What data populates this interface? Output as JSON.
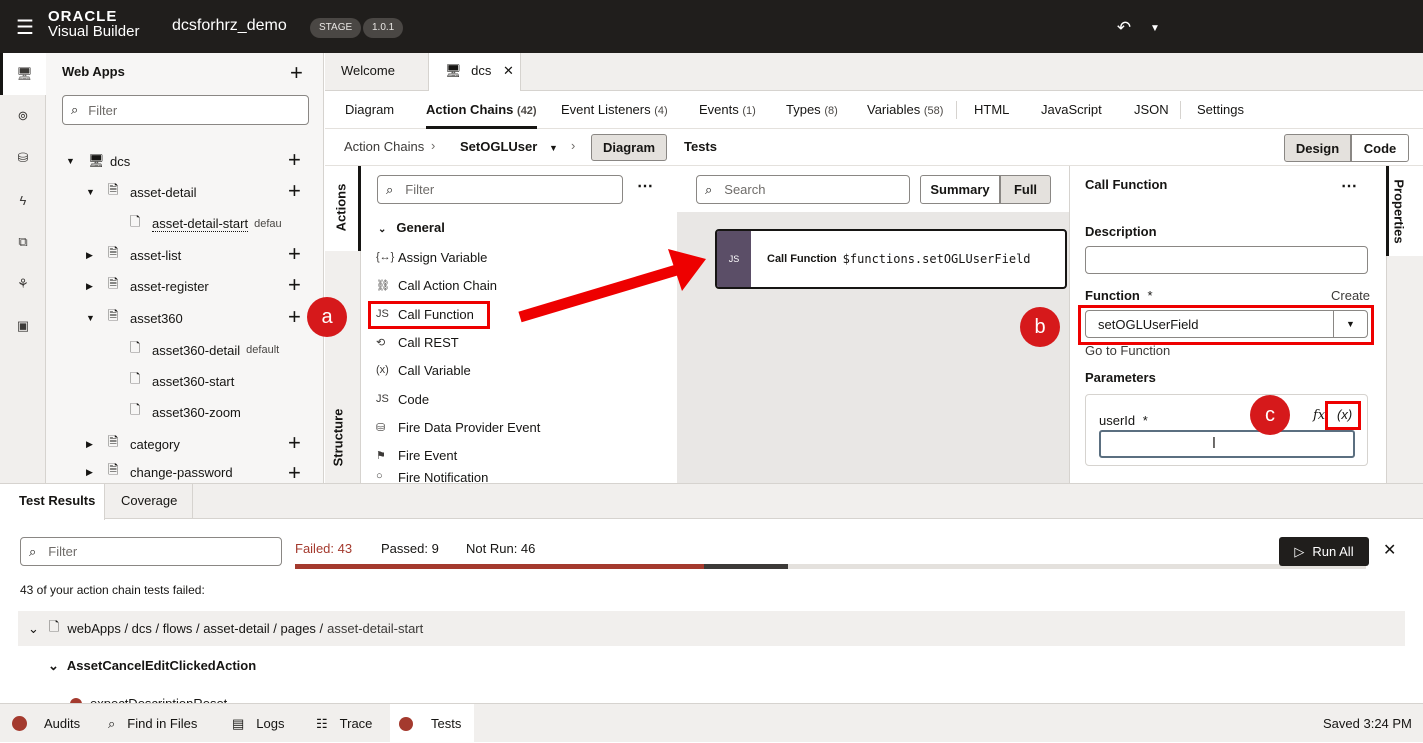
{
  "app": {
    "brand_top": "ORACLE",
    "brand_bottom": "Visual Builder",
    "project": "dcsforhrz_demo",
    "stage_badge": "STAGE",
    "version_badge": "1.0.1"
  },
  "nav": {
    "title": "Web Apps",
    "filter_placeholder": "Filter",
    "tree": [
      {
        "label": "dcs",
        "extra": ""
      },
      {
        "label": "asset-detail",
        "extra": ""
      },
      {
        "label": "asset-detail-start",
        "extra": "defau"
      },
      {
        "label": "asset-list",
        "extra": ""
      },
      {
        "label": "asset-register",
        "extra": ""
      },
      {
        "label": "asset360",
        "extra": ""
      },
      {
        "label": "asset360-detail",
        "extra": "default"
      },
      {
        "label": "asset360-start",
        "extra": ""
      },
      {
        "label": "asset360-zoom",
        "extra": ""
      },
      {
        "label": "category",
        "extra": ""
      },
      {
        "label": "change-password",
        "extra": ""
      }
    ]
  },
  "editor_tabs": [
    {
      "label": "Welcome"
    },
    {
      "label": "dcs"
    }
  ],
  "sub_tabs": [
    {
      "label": "Diagram",
      "count": ""
    },
    {
      "label": "Action Chains",
      "count": "(42)"
    },
    {
      "label": "Event Listeners",
      "count": "(4)"
    },
    {
      "label": "Events",
      "count": "(1)"
    },
    {
      "label": "Types",
      "count": "(8)"
    },
    {
      "label": "Variables",
      "count": "(58)"
    },
    {
      "label": "HTML",
      "count": ""
    },
    {
      "label": "JavaScript",
      "count": ""
    },
    {
      "label": "JSON",
      "count": ""
    },
    {
      "label": "Settings",
      "count": ""
    }
  ],
  "breadcrumb": {
    "root": "Action Chains",
    "current": "SetOGLUser",
    "diagram_btn": "Diagram",
    "tests_btn": "Tests",
    "design_btn": "Design",
    "code_btn": "Code"
  },
  "actions_panel": {
    "side_tab_actions": "Actions",
    "side_tab_structure": "Structure",
    "filter_placeholder": "Filter",
    "group": "General",
    "items": [
      {
        "label": "Assign Variable",
        "icon": "{↔}"
      },
      {
        "label": "Call Action Chain",
        "icon": "⛓"
      },
      {
        "label": "Call Function",
        "icon": "JS"
      },
      {
        "label": "Call REST",
        "icon": "⟲"
      },
      {
        "label": "Call Variable",
        "icon": "(x)"
      },
      {
        "label": "Code",
        "icon": "JS"
      },
      {
        "label": "Fire Data Provider Event",
        "icon": "⛁"
      },
      {
        "label": "Fire Event",
        "icon": "⚑"
      },
      {
        "label": "Fire Notification",
        "icon": "○"
      }
    ]
  },
  "canvas": {
    "search_placeholder": "Search",
    "summary_btn": "Summary",
    "full_btn": "Full",
    "node_title": "Call Function",
    "node_value": "$functions.setOGLUserField"
  },
  "properties": {
    "title": "Call Function",
    "side_tab": "Properties",
    "description_label": "Description",
    "description_value": "",
    "function_label": "Function",
    "required_mark": "*",
    "create_link": "Create",
    "function_value": "setOGLUserField",
    "goto_link": "Go to Function",
    "parameters_label": "Parameters",
    "param_name": "userId",
    "fx_label": "fx",
    "var_label": "(x)"
  },
  "callouts": {
    "a": "a",
    "b": "b",
    "c": "c"
  },
  "test_results": {
    "tab_results": "Test Results",
    "tab_coverage": "Coverage",
    "filter_placeholder": "Filter",
    "failed": "Failed: 43",
    "passed": "Passed: 9",
    "not_run": "Not Run: 46",
    "run_all": "Run All",
    "summary": "43 of your action chain tests failed:",
    "path_prefix": "webApps / dcs / flows / asset-detail / pages /",
    "path_page": "asset-detail-start",
    "action": "AssetCancelEditClickedAction",
    "cut_item": "expectDescriptionReset",
    "failed_fraction": 0.83,
    "passed_fraction": 0.17,
    "run_fraction": 0.46
  },
  "statusbar": {
    "items": [
      "Audits",
      "Find in Files",
      "Logs",
      "Trace",
      "Tests"
    ],
    "saved": "Saved 3:24 PM"
  },
  "colors": {
    "topbar": "#201e1c",
    "accent_red": "#e00000",
    "failed_bar": "#a43a2e",
    "node_strip": "#5b4e67"
  }
}
